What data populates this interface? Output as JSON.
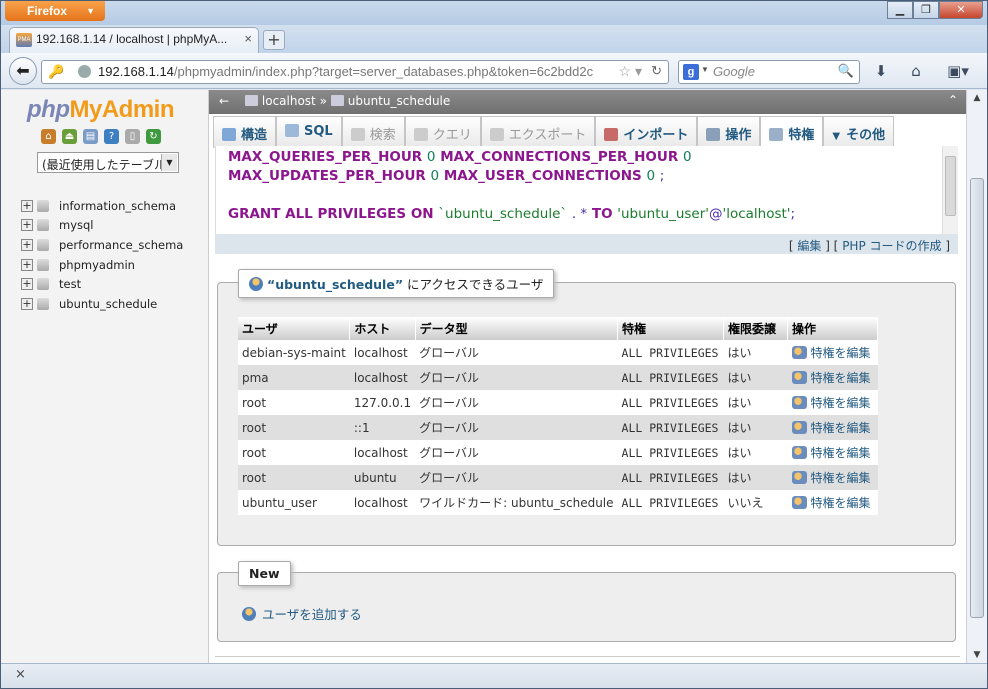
{
  "browser": {
    "menu_button": "Firefox",
    "window_controls": {
      "minimize": "▁",
      "restore": "❐",
      "close": "✕"
    },
    "tab_title": "192.168.1.14 / localhost | phpMyA...",
    "tab_close": "×",
    "new_tab": "+",
    "url_host": "192.168.1.14",
    "url_rest": "/phpmyadmin/index.php?target=server_databases.php&token=6c2bdd2c",
    "search_engine_letter": "g",
    "search_placeholder": "Google",
    "status_close": "×"
  },
  "pma": {
    "logo_php": "php",
    "logo_my": "MyAdmin",
    "recent_tables": "(最近使用したテーブル",
    "databases": [
      "information_schema",
      "mysql",
      "performance_schema",
      "phpmyadmin",
      "test",
      "ubuntu_schedule"
    ],
    "breadcrumb": {
      "server": "localhost",
      "database": "ubuntu_schedule"
    },
    "tabs": [
      {
        "label": "構造",
        "state": "normal"
      },
      {
        "label": "SQL",
        "state": "normal"
      },
      {
        "label": "検索",
        "state": "disabled"
      },
      {
        "label": "クエリ",
        "state": "disabled"
      },
      {
        "label": "エクスポート",
        "state": "disabled"
      },
      {
        "label": "インポート",
        "state": "normal"
      },
      {
        "label": "操作",
        "state": "normal"
      },
      {
        "label": "特権",
        "state": "active"
      },
      {
        "label": "その他",
        "state": "normal"
      }
    ],
    "sql": {
      "line1_kw1": "MAX_QUERIES_PER_HOUR",
      "line1_n1": "0",
      "line1_kw2": "MAX_CONNECTIONS_PER_HOUR",
      "line1_n2": "0",
      "line2_kw1": "MAX_UPDATES_PER_HOUR",
      "line2_n1": "0",
      "line2_kw2": "MAX_USER_CONNECTIONS",
      "line2_n2": "0",
      "line2_end": ";",
      "grant_kw": "GRANT ALL PRIVILEGES ON",
      "grant_db": "`ubuntu_schedule`",
      "grant_dot": ". *",
      "grant_to": "TO",
      "grant_user": "'ubuntu_user'",
      "grant_at": "@",
      "grant_host": "'localhost'",
      "grant_end": ";"
    },
    "sql_links": {
      "edit": "編集",
      "php_code": "PHP コードの作成"
    },
    "users_section": {
      "legend_db": "“ubuntu_schedule”",
      "legend_text": " にアクセスできるユーザ",
      "columns": [
        "ユーザ",
        "ホスト",
        "データ型",
        "特権",
        "権限委譲",
        "操作"
      ],
      "rows": [
        {
          "user": "debian-sys-maint",
          "host": "localhost",
          "type": "グローバル",
          "priv": "ALL PRIVILEGES",
          "grant": "はい",
          "action": "特権を編集"
        },
        {
          "user": "pma",
          "host": "localhost",
          "type": "グローバル",
          "priv": "ALL PRIVILEGES",
          "grant": "はい",
          "action": "特権を編集"
        },
        {
          "user": "root",
          "host": "127.0.0.1",
          "type": "グローバル",
          "priv": "ALL PRIVILEGES",
          "grant": "はい",
          "action": "特権を編集"
        },
        {
          "user": "root",
          "host": "::1",
          "type": "グローバル",
          "priv": "ALL PRIVILEGES",
          "grant": "はい",
          "action": "特権を編集"
        },
        {
          "user": "root",
          "host": "localhost",
          "type": "グローバル",
          "priv": "ALL PRIVILEGES",
          "grant": "はい",
          "action": "特権を編集"
        },
        {
          "user": "root",
          "host": "ubuntu",
          "type": "グローバル",
          "priv": "ALL PRIVILEGES",
          "grant": "はい",
          "action": "特権を編集"
        },
        {
          "user": "ubuntu_user",
          "host": "localhost",
          "type": "ワイルドカード: ubuntu_schedule",
          "priv": "ALL PRIVILEGES",
          "grant": "いいえ",
          "action": "特権を編集"
        }
      ]
    },
    "new_section": {
      "legend": "New",
      "add_user": "ユーザを追加する"
    }
  }
}
